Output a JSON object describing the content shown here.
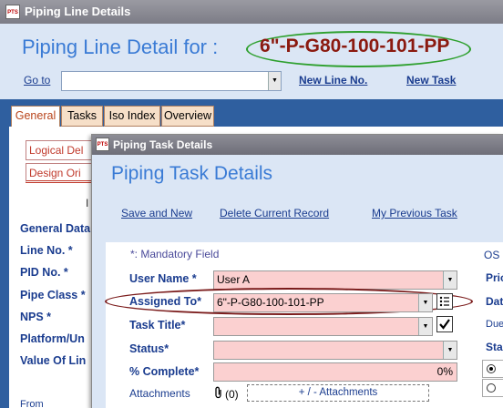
{
  "outer_window": {
    "title": "Piping Line Details",
    "logo_text": "PTS",
    "header_title": "Piping Line Detail for :",
    "line_number": "6\"-P-G80-100-101-PP",
    "goto_label": "Go to",
    "goto_value": "",
    "new_line_link": "New Line No.",
    "new_task_link": "New Task",
    "tabs": [
      {
        "label": "General",
        "active": true
      },
      {
        "label": "Tasks",
        "active": false
      },
      {
        "label": "Iso Index",
        "active": false
      },
      {
        "label": "Overview",
        "active": false
      }
    ],
    "sub_tabs": [
      "Logical Del",
      "Design Ori"
    ],
    "partial_labels": [
      "General Data",
      "Line No. *",
      "PID No. *",
      "Pipe Class *",
      "NPS *",
      "Platform/Un",
      "Value Of Lin",
      "From"
    ],
    "fragment_I": "I"
  },
  "dialog": {
    "title": "Piping Task Details",
    "logo_text": "PTS",
    "heading": "Piping Task Details",
    "links": {
      "save_new": "Save and New",
      "delete_current": "Delete Current Record",
      "my_previous": "My Previous Task"
    },
    "mandatory_note": "*: Mandatory Field",
    "os_label": "OS",
    "fields": {
      "user_name": {
        "label": "User Name *",
        "value": "User A"
      },
      "assigned_to": {
        "label": "Assigned To*",
        "value": "6\"-P-G80-100-101-PP"
      },
      "task_title": {
        "label": "Task Title*",
        "value": ""
      },
      "status": {
        "label": "Status*",
        "value": ""
      },
      "percent_complete": {
        "label": "% Complete*",
        "value": "0%"
      }
    },
    "attachments": {
      "label": "Attachments",
      "count": "(0)",
      "button": "+ / -  Attachments"
    },
    "right_fragments": [
      "Pric",
      "Dat",
      "Due",
      "Sta"
    ]
  },
  "colors": {
    "accent_blue": "#3a7bd5",
    "required_field_bg": "#fbd0d0",
    "highlight_green": "#2ea02e",
    "highlight_maroon": "#7a1a1a",
    "tab_bar": "#2f5f9f"
  },
  "icons": [
    "paperclip-icon",
    "list-icon",
    "checkbox-checked-icon",
    "dropdown-arrow-icon"
  ]
}
